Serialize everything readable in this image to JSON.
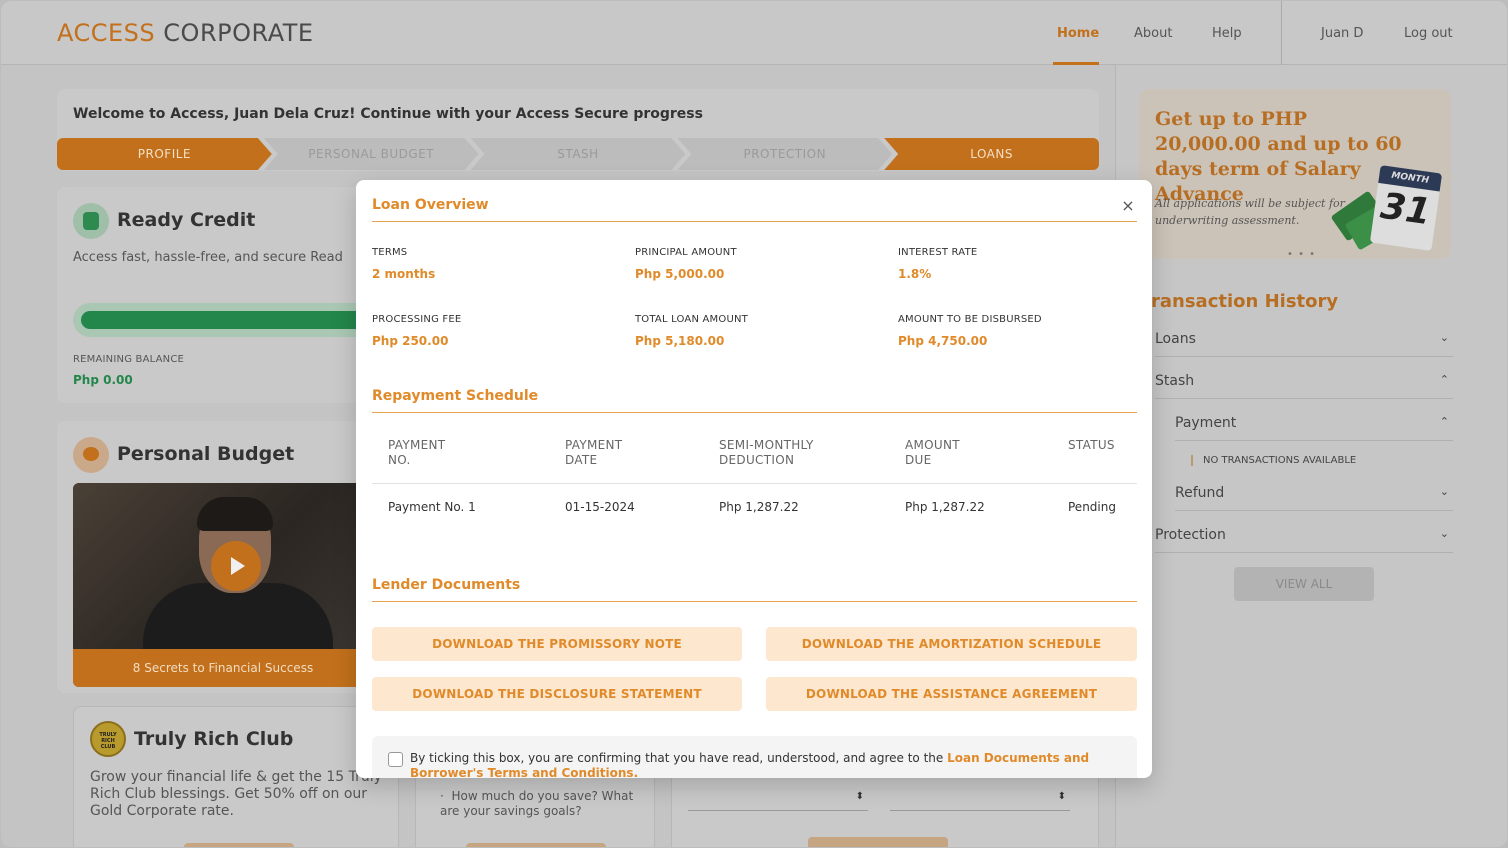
{
  "header": {
    "logo_accent": "ACCESS",
    "logo_rest": "CORPORATE",
    "nav": [
      "Home",
      "About",
      "Help"
    ],
    "user": "Juan D",
    "logout": "Log out"
  },
  "welcome": {
    "text": "Welcome to Access, Juan Dela Cruz! Continue with your Access Secure progress",
    "steps": [
      "PROFILE",
      "PERSONAL BUDGET",
      "STASH",
      "PROTECTION",
      "LOANS"
    ]
  },
  "ready_credit": {
    "title": "Ready Credit",
    "description": "Access fast, hassle-free, and secure Read",
    "remaining_label": "REMAINING BALANCE",
    "remaining_value": "Php 0.00",
    "progress": 1.0
  },
  "personal_budget": {
    "title": "Personal Budget",
    "video_caption": "8 Secrets to Financial Success"
  },
  "truly_rich": {
    "title": "Truly Rich Club",
    "badge": "TRULY RICH CLUB",
    "description": "Grow your financial life & get the 15 Truly Rich Club blessings. Get 50% off on our Gold Corporate rate."
  },
  "savings_card": {
    "bullet": "How much do you save? What are your savings goals?"
  },
  "promo": {
    "title": "Get up to PHP 20,000.00 and up to 60 days term of Salary Advance",
    "note": "All applications will be subject for underwriting assessment.",
    "calendar_month": "MONTH",
    "calendar_day": "31"
  },
  "transactions": {
    "title": "ransaction History",
    "rows": [
      {
        "label": "Loans",
        "chevron": "⌄"
      },
      {
        "label": "Stash",
        "chevron": "⌃"
      },
      {
        "label": "Payment",
        "chevron": "⌃"
      },
      {
        "label": "Refund",
        "chevron": "⌄"
      },
      {
        "label": "Protection",
        "chevron": "⌄"
      }
    ],
    "empty": "NO TRANSACTIONS AVAILABLE",
    "view_all": "VIEW ALL"
  },
  "modal": {
    "title": "Loan Overview",
    "close": "×",
    "fields": [
      {
        "label": "TERMS",
        "value": "2 months"
      },
      {
        "label": "PRINCIPAL AMOUNT",
        "value": "Php 5,000.00"
      },
      {
        "label": "INTEREST RATE",
        "value": "1.8%"
      },
      {
        "label": "PROCESSING FEE",
        "value": "Php 250.00"
      },
      {
        "label": "TOTAL LOAN AMOUNT",
        "value": "Php 5,180.00"
      },
      {
        "label": "AMOUNT TO BE DISBURSED",
        "value": "Php 4,750.00"
      }
    ],
    "schedule_title": "Repayment Schedule",
    "schedule_headers": [
      [
        "PAYMENT",
        "NO."
      ],
      [
        "PAYMENT",
        "DATE"
      ],
      [
        "SEMI-MONTHLY",
        "DEDUCTION"
      ],
      [
        "AMOUNT",
        "DUE"
      ],
      [
        "STATUS",
        ""
      ]
    ],
    "schedule_rows": [
      [
        "Payment No. 1",
        "01-15-2024",
        "Php 1,287.22",
        "Php 1,287.22",
        "Pending"
      ]
    ],
    "documents_title": "Lender Documents",
    "documents": [
      "DOWNLOAD THE PROMISSORY NOTE",
      "DOWNLOAD THE AMORTIZATION SCHEDULE",
      "DOWNLOAD THE DISCLOSURE STATEMENT",
      "DOWNLOAD THE ASSISTANCE AGREEMENT"
    ],
    "agree_text": "By ticking this box, you are confirming that you have read, understood, and agree to the ",
    "agree_link": "Loan Documents and Borrower's Terms and Conditions."
  },
  "colors": {
    "accent": "#e08a2a",
    "accent_dim": "#c2701b",
    "overlay": "#c4c4c4"
  }
}
